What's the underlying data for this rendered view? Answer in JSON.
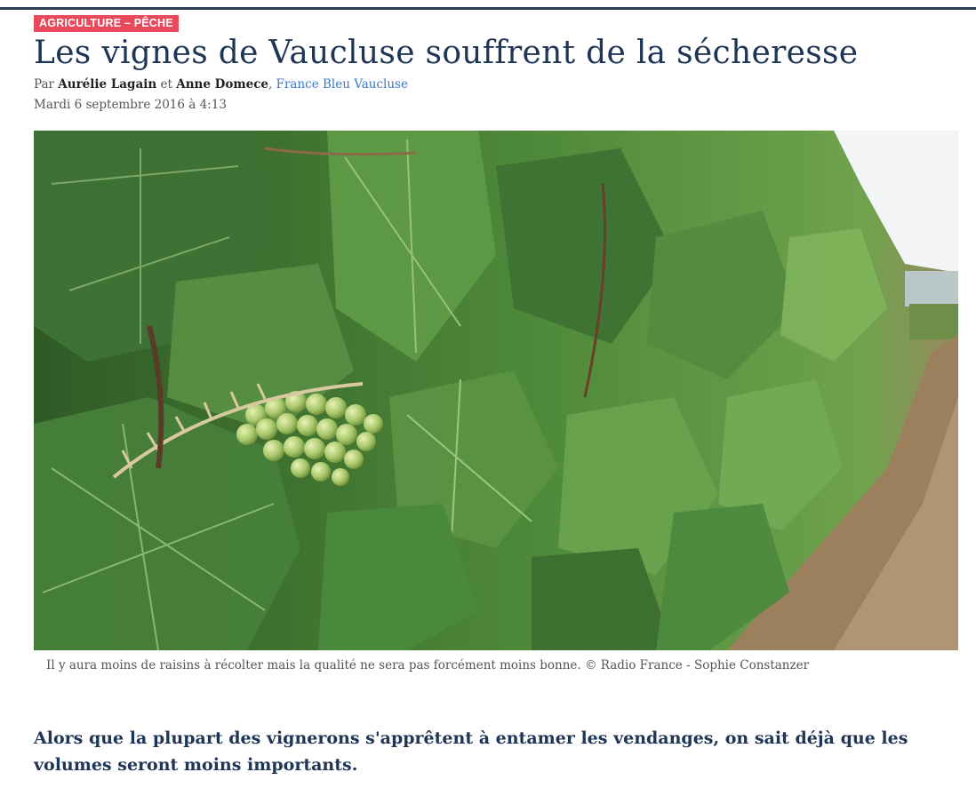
{
  "article": {
    "category": "AGRICULTURE – PÊCHE",
    "title": "Les vignes de Vaucluse souffrent de la sécheresse",
    "byline": {
      "prefix": "Par",
      "author1": "Aurélie Lagain",
      "conjunction": "et",
      "author2": "Anne Domece",
      "station": "France Bleu Vaucluse"
    },
    "date": "Mardi 6 septembre 2016 à 4:13",
    "photo": {
      "caption": "Il y aura moins de raisins à récolter mais la qualité ne sera pas forcément moins bonne. © Radio France - Sophie Constanzer"
    },
    "lead": "Alors que la plupart des vignerons s'apprêtent à entamer les vendanges, on sait déjà que les volumes seront moins importants."
  },
  "colors": {
    "category_bg": "#e8495b",
    "title": "#1e3555",
    "link": "#3a78c9"
  }
}
